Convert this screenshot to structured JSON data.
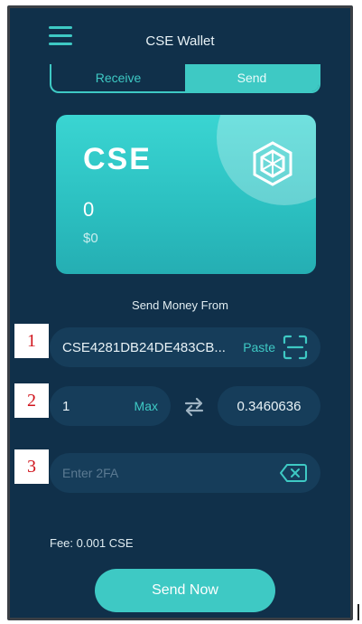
{
  "header": {
    "title": "CSE Wallet",
    "menu_icon": "hamburger-menu-icon"
  },
  "tabs": [
    {
      "label": "Receive",
      "active": false
    },
    {
      "label": "Send",
      "active": true
    }
  ],
  "card": {
    "coin": "CSE",
    "balance": "0",
    "usd_value": "$0",
    "logo_icon": "hexagon-logo-icon"
  },
  "form": {
    "section_label": "Send Money From",
    "address": "CSE4281DB24DE483CB...",
    "paste_label": "Paste",
    "amount": "1",
    "max_label": "Max",
    "converted": "0.3460636",
    "twofa_placeholder": "Enter 2FA",
    "fee": "Fee: 0.001 CSE",
    "send_label": "Send Now"
  },
  "annotations": [
    "1",
    "2",
    "3"
  ],
  "colors": {
    "accent": "#3ec9c4",
    "background": "#10304a",
    "field": "#163d5a",
    "marker": "#d0141c"
  }
}
